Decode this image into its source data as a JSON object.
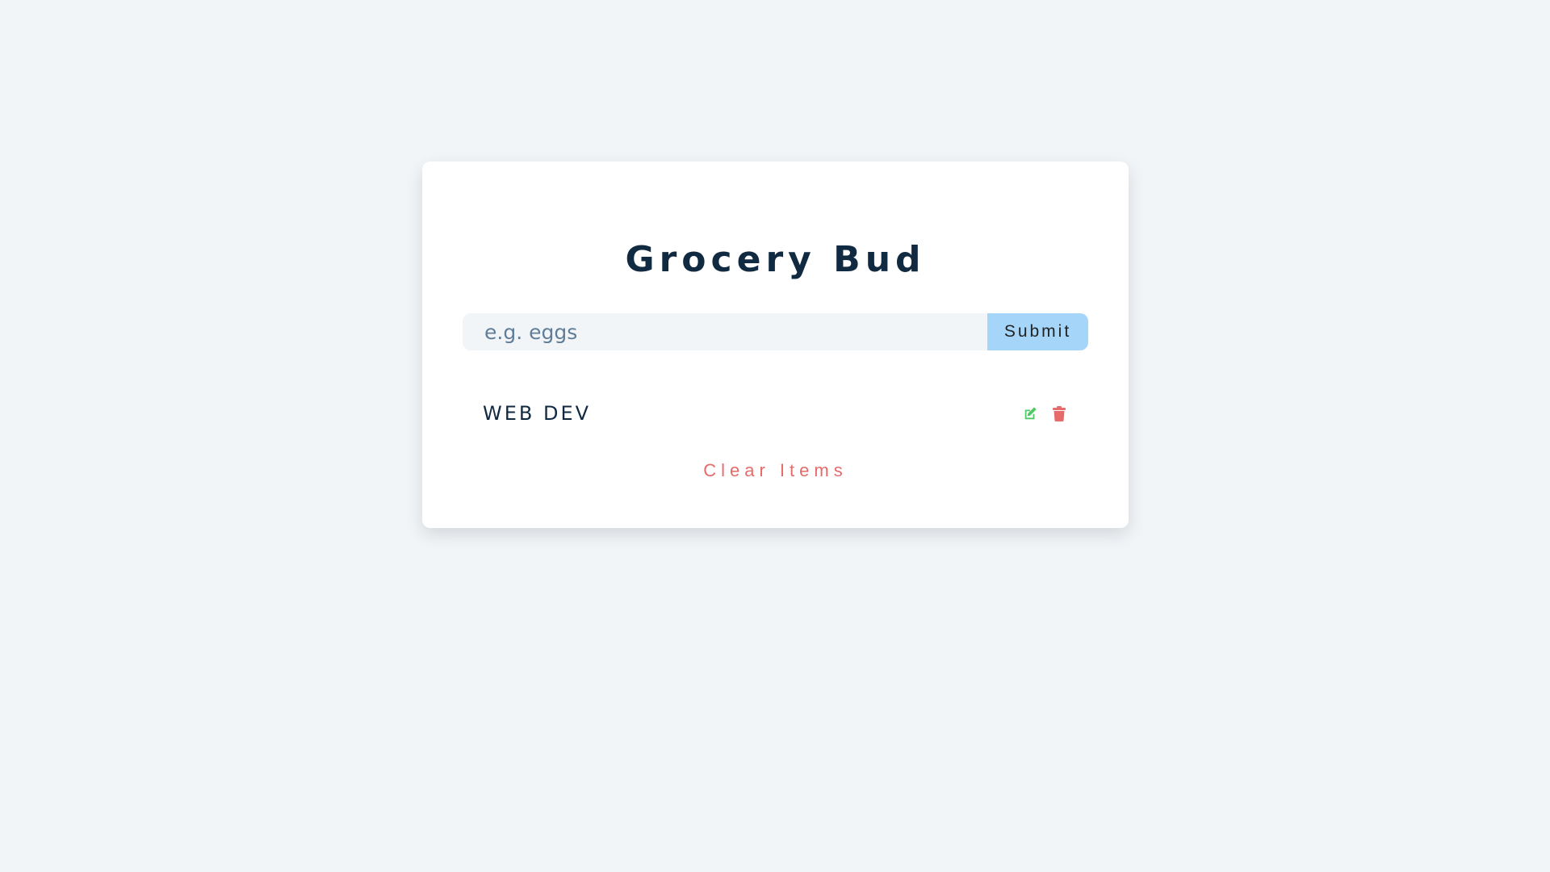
{
  "app": {
    "title": "Grocery Bud"
  },
  "form": {
    "placeholder": "e.g. eggs",
    "value": "",
    "submit_label": "Submit"
  },
  "items": [
    {
      "title": "WEB DEV",
      "edit_icon": "edit-icon",
      "delete_icon": "trash-icon"
    }
  ],
  "footer": {
    "clear_label": "Clear Items"
  },
  "colors": {
    "background": "#f1f5f8",
    "title": "#102a42",
    "submit_bg": "#a5d5f8",
    "edit": "#4ec963",
    "delete": "#e66b6b"
  }
}
